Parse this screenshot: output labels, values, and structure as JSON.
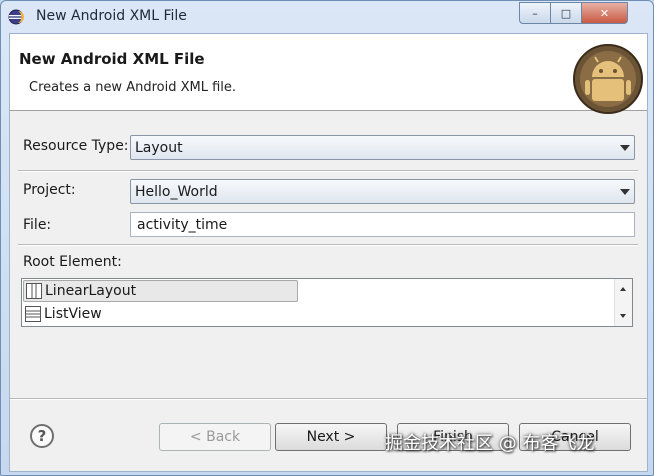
{
  "window": {
    "title": "New Android XML File",
    "controls": {
      "minimize": "–",
      "maximize": "□",
      "close": "✕"
    }
  },
  "header": {
    "title": "New Android XML File",
    "description": "Creates a new Android XML file."
  },
  "form": {
    "resource_type": {
      "label": "Resource Type:",
      "value": "Layout"
    },
    "project": {
      "label": "Project:",
      "value": "Hello_World"
    },
    "file": {
      "label": "File:",
      "value": "activity_time"
    },
    "root_element": {
      "label": "Root Element:",
      "items": [
        "LinearLayout",
        "ListView"
      ],
      "selected": "LinearLayout"
    }
  },
  "footer": {
    "help": "?",
    "back": "< Back",
    "next": "Next >",
    "finish": "Finish",
    "cancel": "Cancel"
  },
  "watermark": "掘金技术社区 @ 布客飞龙",
  "colors": {
    "title_bar": "#c6d8ef",
    "client": "#f0f0f0",
    "close_button": "#c85a44",
    "logo_bg": "#6b5436"
  }
}
